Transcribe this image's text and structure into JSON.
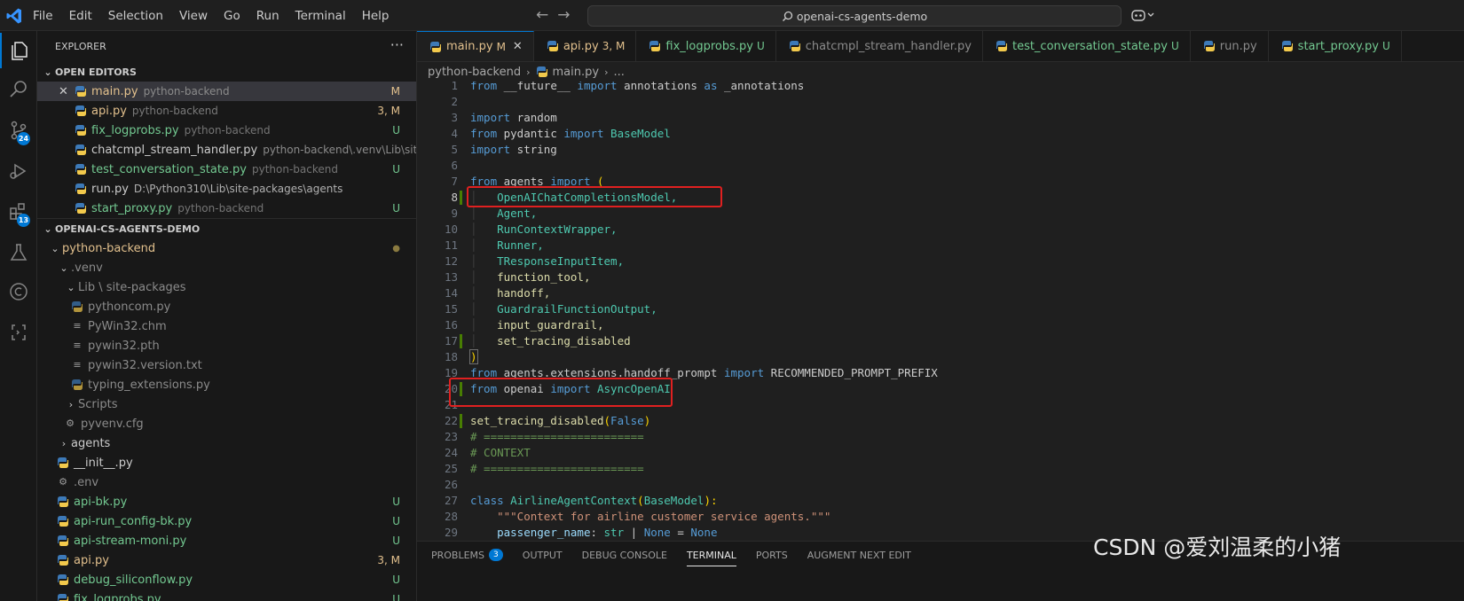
{
  "menu": [
    "File",
    "Edit",
    "Selection",
    "View",
    "Go",
    "Run",
    "Terminal",
    "Help"
  ],
  "search": {
    "text": "openai-cs-agents-demo"
  },
  "activity_badges": {
    "scm": "24",
    "extensions": "13"
  },
  "explorer": {
    "title": "EXPLORER",
    "open_editors_label": "OPEN EDITORS",
    "open_editors": [
      {
        "name": "main.py",
        "desc": "python-backend",
        "status": "M"
      },
      {
        "name": "api.py",
        "desc": "python-backend",
        "status": "3, M"
      },
      {
        "name": "fix_logprobs.py",
        "desc": "python-backend",
        "status": "U"
      },
      {
        "name": "chatcmpl_stream_handler.py",
        "desc": "python-backend\\.venv\\Lib\\site-pac...",
        "status": ""
      },
      {
        "name": "test_conversation_state.py",
        "desc": "python-backend",
        "status": "U"
      },
      {
        "name": "run.py",
        "desc": "D:\\Python310\\Lib\\site-packages\\agents",
        "status": ""
      },
      {
        "name": "start_proxy.py",
        "desc": "python-backend",
        "status": "U"
      }
    ],
    "project_label": "OPENAI-CS-AGENTS-DEMO",
    "tree": [
      {
        "name": "python-backend",
        "status": "●"
      },
      {
        "name": ".venv",
        "status": ""
      },
      {
        "name": "Lib \\ site-packages",
        "status": ""
      },
      {
        "name": "pythoncom.py",
        "status": ""
      },
      {
        "name": "PyWin32.chm",
        "status": ""
      },
      {
        "name": "pywin32.pth",
        "status": ""
      },
      {
        "name": "pywin32.version.txt",
        "status": ""
      },
      {
        "name": "typing_extensions.py",
        "status": ""
      },
      {
        "name": "Scripts",
        "status": ""
      },
      {
        "name": "pyvenv.cfg",
        "status": ""
      },
      {
        "name": "agents",
        "status": ""
      },
      {
        "name": "__init__.py",
        "status": ""
      },
      {
        "name": ".env",
        "status": ""
      },
      {
        "name": "api-bk.py",
        "status": "U"
      },
      {
        "name": "api-run_config-bk.py",
        "status": "U"
      },
      {
        "name": "api-stream-moni.py",
        "status": "U"
      },
      {
        "name": "api.py",
        "status": "3, M"
      },
      {
        "name": "debug_siliconflow.py",
        "status": "U"
      },
      {
        "name": "fix_logprobs.py",
        "status": "U"
      }
    ]
  },
  "tabs": [
    {
      "name": "main.py",
      "status": "M"
    },
    {
      "name": "api.py",
      "status": "3, M"
    },
    {
      "name": "fix_logprobs.py",
      "status": "U"
    },
    {
      "name": "chatcmpl_stream_handler.py",
      "status": ""
    },
    {
      "name": "test_conversation_state.py",
      "status": "U"
    },
    {
      "name": "run.py",
      "status": ""
    },
    {
      "name": "start_proxy.py",
      "status": "U"
    }
  ],
  "breadcrumb": [
    "python-backend",
    "main.py",
    "..."
  ],
  "code": {
    "l1": [
      "from",
      " __future__ ",
      "import",
      " annotations ",
      "as",
      " _annotations"
    ],
    "l3": [
      "import",
      " random"
    ],
    "l4": [
      "from",
      " pydantic ",
      "import",
      " BaseModel"
    ],
    "l5": [
      "import",
      " string"
    ],
    "l7": [
      "from",
      " agents ",
      "import",
      " ",
      "("
    ],
    "l8": "OpenAIChatCompletionsModel,",
    "l9": "Agent,",
    "l10": "RunContextWrapper,",
    "l11": "Runner,",
    "l12": "TResponseInputItem,",
    "l13": "function_tool,",
    "l14": "handoff,",
    "l15": "GuardrailFunctionOutput,",
    "l16": "input_guardrail,",
    "l17": "set_tracing_disabled",
    "l18": ")",
    "l19": [
      "from",
      " agents.extensions.handoff_prompt ",
      "import",
      " RECOMMENDED_PROMPT_PREFIX"
    ],
    "l20": [
      "from",
      " openai ",
      "import",
      " AsyncOpenAI"
    ],
    "l22": [
      "set_tracing_disabled",
      "(",
      "False",
      ")"
    ],
    "l23": "# ========================",
    "l24": "# CONTEXT",
    "l25": "# ========================",
    "l27": [
      "class",
      " ",
      "AirlineAgentContext",
      "(",
      "BaseModel",
      "):"
    ],
    "l28": "\"\"\"Context for airline customer service agents.\"\"\"",
    "l29": [
      "passenger_name",
      ": ",
      "str",
      " | ",
      "None",
      " = ",
      "None"
    ]
  },
  "panel": {
    "tabs": [
      "PROBLEMS",
      "OUTPUT",
      "DEBUG CONSOLE",
      "TERMINAL",
      "PORTS",
      "AUGMENT NEXT EDIT"
    ],
    "problems_count": "3",
    "active": "TERMINAL"
  },
  "watermark": "CSDN @爱刘温柔的小猪",
  "colors": {
    "accent": "#0078d4",
    "modified": "#e2c08d",
    "untracked": "#73c991",
    "highlight_box": "#e02020"
  }
}
